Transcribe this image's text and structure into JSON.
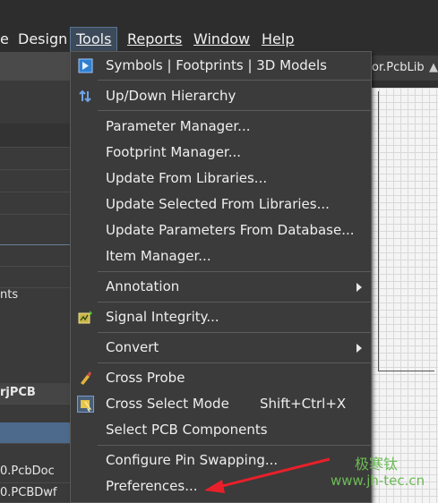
{
  "menubar": {
    "items": [
      {
        "label": "e"
      },
      {
        "label": "Design"
      },
      {
        "label": "Tools"
      },
      {
        "label": "Reports"
      },
      {
        "label": "Window"
      },
      {
        "label": "Help"
      }
    ]
  },
  "left_panel": {
    "rows": [
      {
        "text": "nts"
      },
      {
        "text": "rjPCB"
      },
      {
        "text": "0.PcbDoc"
      },
      {
        "text": "0.PCBDwf"
      }
    ]
  },
  "document_tab": {
    "label": "or.PcbLib"
  },
  "tools_menu": {
    "items": [
      {
        "label": "Symbols | Footprints | 3D Models",
        "icon": "3d-model-icon"
      },
      {
        "label": "Up/Down Hierarchy",
        "icon": "hierarchy-arrows-icon"
      },
      {
        "label": "Parameter Manager..."
      },
      {
        "label": "Footprint Manager..."
      },
      {
        "label": "Update From Libraries..."
      },
      {
        "label": "Update Selected From Libraries..."
      },
      {
        "label": "Update Parameters From Database..."
      },
      {
        "label": "Item Manager..."
      },
      {
        "label": "Annotation",
        "submenu": true
      },
      {
        "label": "Signal Integrity...",
        "icon": "signal-integrity-icon"
      },
      {
        "label": "Convert",
        "submenu": true
      },
      {
        "label": "Cross Probe",
        "icon": "cross-probe-icon"
      },
      {
        "label": "Cross Select Mode",
        "shortcut": "Shift+Ctrl+X",
        "icon": "cross-select-icon"
      },
      {
        "label": "Select PCB Components"
      },
      {
        "label": "Configure Pin Swapping..."
      },
      {
        "label": "Preferences..."
      }
    ]
  },
  "watermark": {
    "cn": "极寒钛",
    "url": "www.jh-tec.cn"
  },
  "colors": {
    "menu_bg": "#3b3b3b",
    "active_menu": "#3c4a5a",
    "annotation_arrow": "#e8202a",
    "watermark": "#6dbb56"
  }
}
